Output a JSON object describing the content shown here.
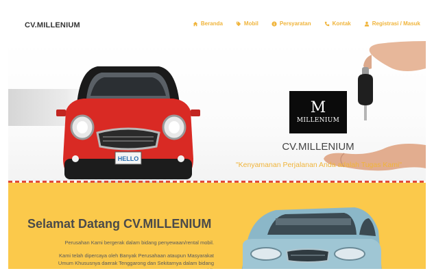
{
  "header": {
    "brand": "CV.MILLENIUM",
    "nav": [
      {
        "label": "Beranda",
        "icon": "home-icon"
      },
      {
        "label": "Mobil",
        "icon": "tag-icon"
      },
      {
        "label": "Persyaratan",
        "icon": "info-icon"
      },
      {
        "label": "Kontak",
        "icon": "phone-icon"
      },
      {
        "label": "Registrasi / Masuk",
        "icon": "user-icon"
      }
    ]
  },
  "hero": {
    "logo_letter": "M",
    "logo_word": "MILLENIUM",
    "title": "CV.MILLENIUM",
    "tagline": "\"Kenyamanan Perjalanan Anda adalah Tugas Kami\"",
    "plate": "HELLO"
  },
  "welcome": {
    "heading": "Selamat Datang CV.MILLENIUM",
    "paragraph_1": "Perusahan Kami bergerak dalam bidang penyewaan/rental mobil.",
    "paragraph_2": "Kami telah dipercaya oleh Banyak Perusahaan ataupun Masyarakat Umum Khususnya daerak Tenggarong dan Sekitarnya dalam bidang penyewaan mobil."
  },
  "colors": {
    "accent": "#f0b43a",
    "yellow_band": "#fbc94b",
    "divider": "#e0493a",
    "car_red": "#d92a24",
    "car_teal": "#8bb7c8"
  }
}
